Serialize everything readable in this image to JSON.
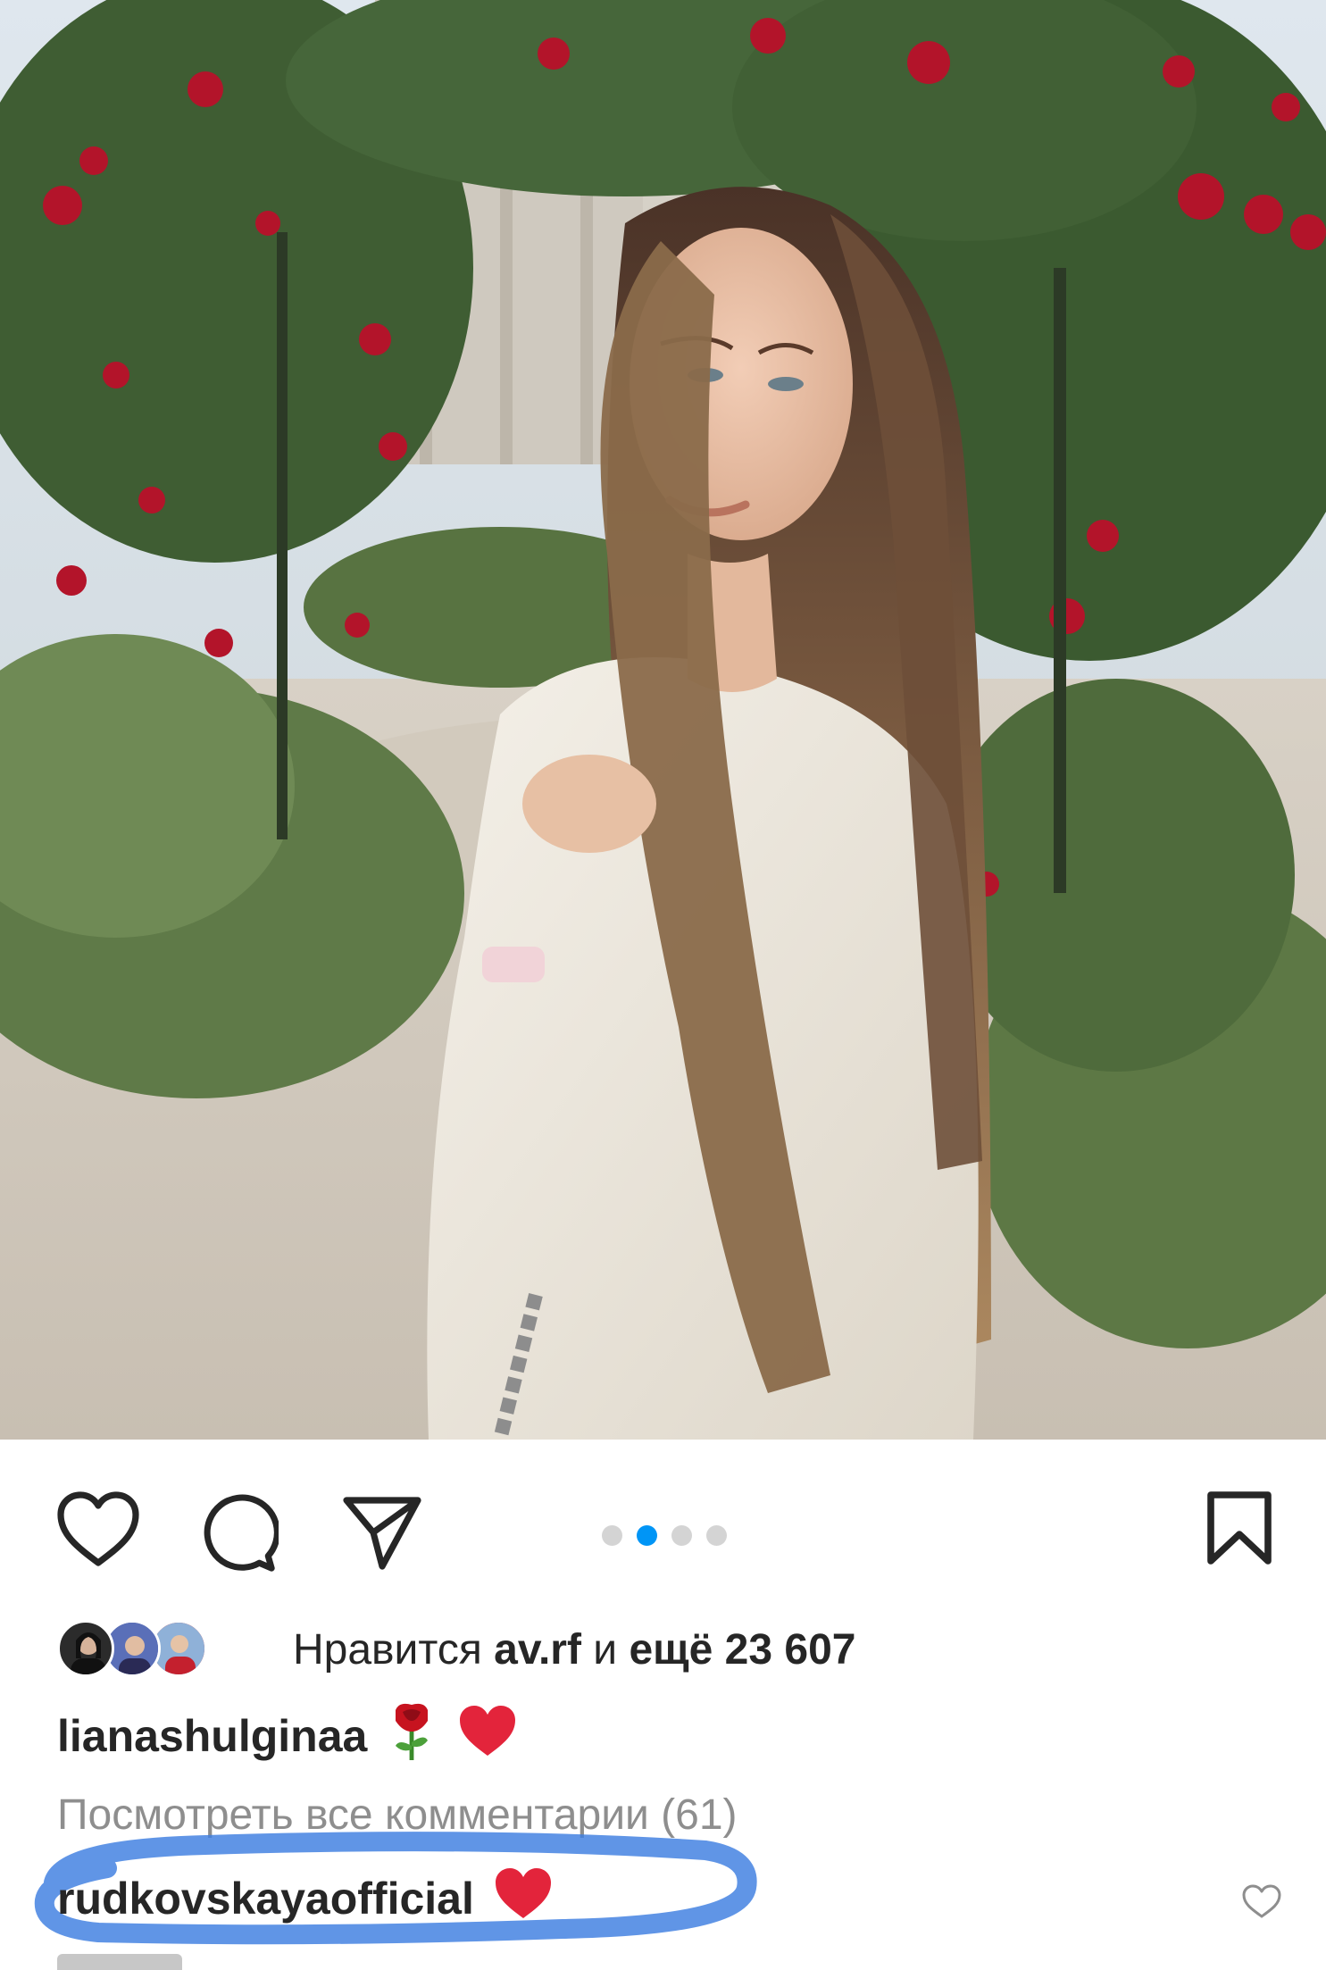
{
  "post": {
    "image_description_icon": "post-photo",
    "carousel": {
      "total": 4,
      "active_index": 1
    }
  },
  "actions": {
    "like_icon": "heart-outline-icon",
    "comment_icon": "comment-bubble-icon",
    "share_icon": "paper-plane-icon",
    "save_icon": "bookmark-icon"
  },
  "likes": {
    "prefix": "Нравится ",
    "user": "av.rf",
    "middle": " и ",
    "rest": "ещё 23 607"
  },
  "caption": {
    "username": "lianashulginaa",
    "emoji_rose": "🌹",
    "emoji_heart": "❤️"
  },
  "comments": {
    "view_all": "Посмотреть все комментарии (61)",
    "first": {
      "username": "rudkovskayaofficial",
      "emoji": "❤️"
    }
  },
  "colors": {
    "accent": "#0095f6",
    "highlight": "#3d7ee0",
    "heart": "#e0245e"
  }
}
